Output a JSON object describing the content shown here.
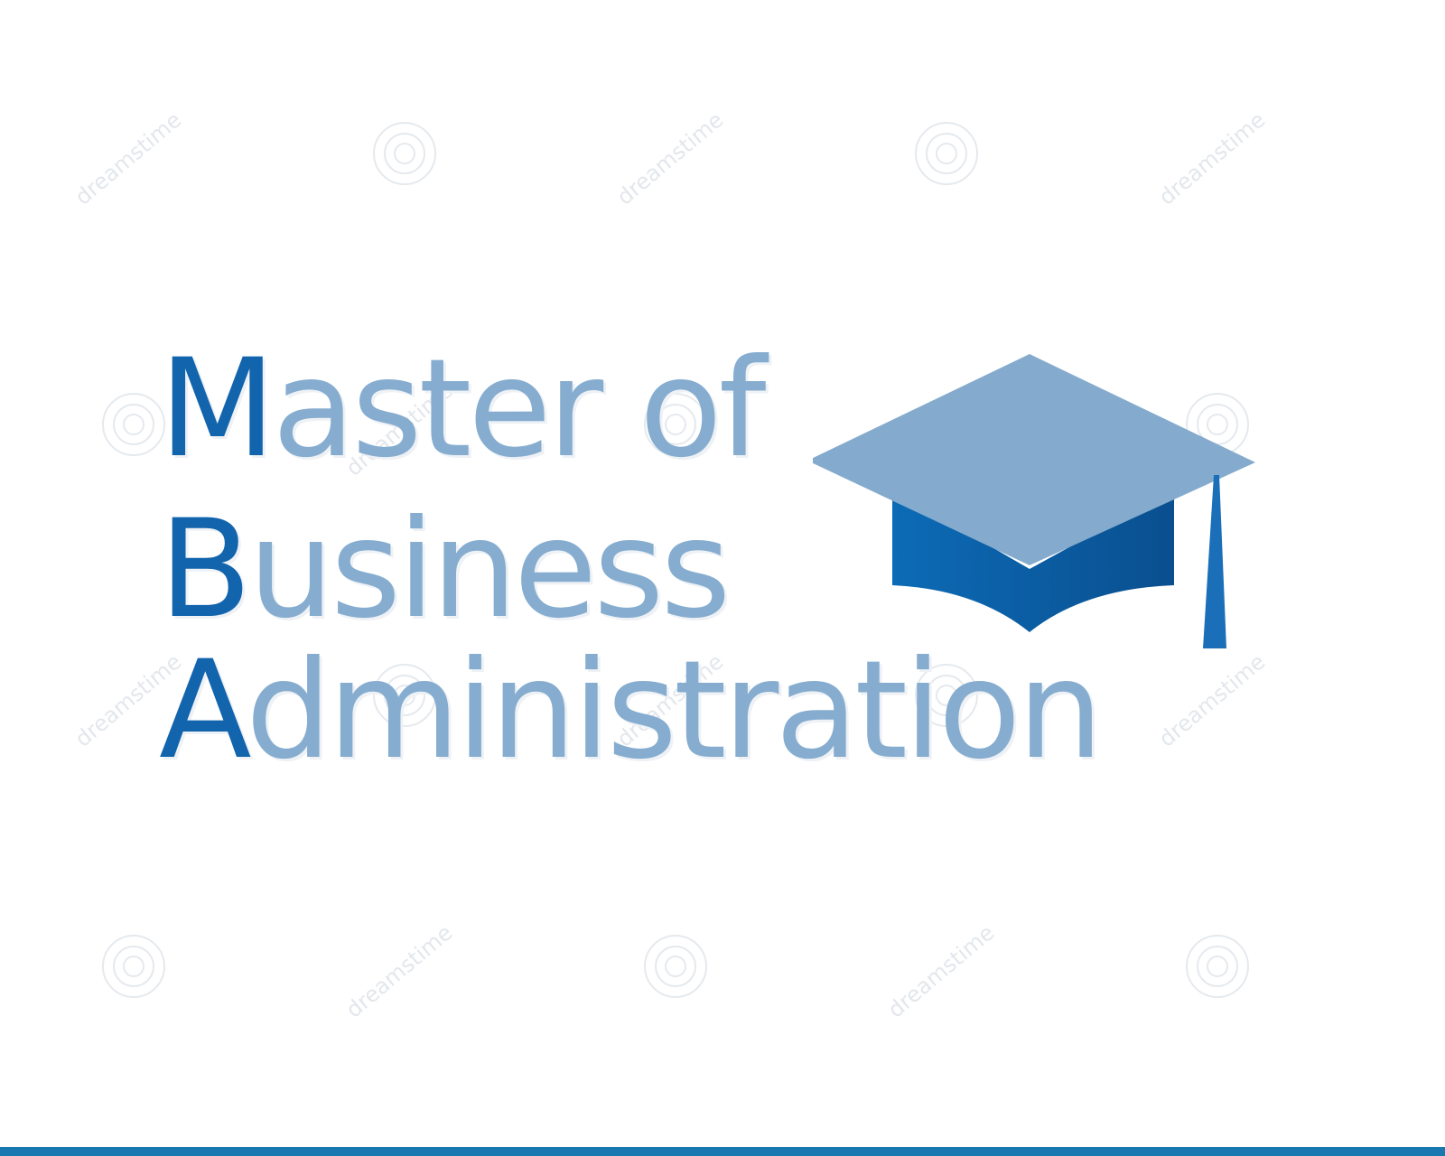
{
  "logo": {
    "line1": {
      "initial": "M",
      "rest": "aster of"
    },
    "line2": {
      "initial": "B",
      "rest": "usiness"
    },
    "line3": {
      "initial": "A",
      "rest": "dministration"
    }
  },
  "watermark": {
    "text": "dreamstime"
  },
  "icons": {
    "cap": "graduation-cap-icon"
  },
  "colors": {
    "initial": "#1264ad",
    "text": "#86adcf",
    "cap_board": "#84abcd",
    "cap_base": "#0f5fa6",
    "tassel": "#1a6fb8",
    "bottom_bar": "#1a78b0"
  }
}
